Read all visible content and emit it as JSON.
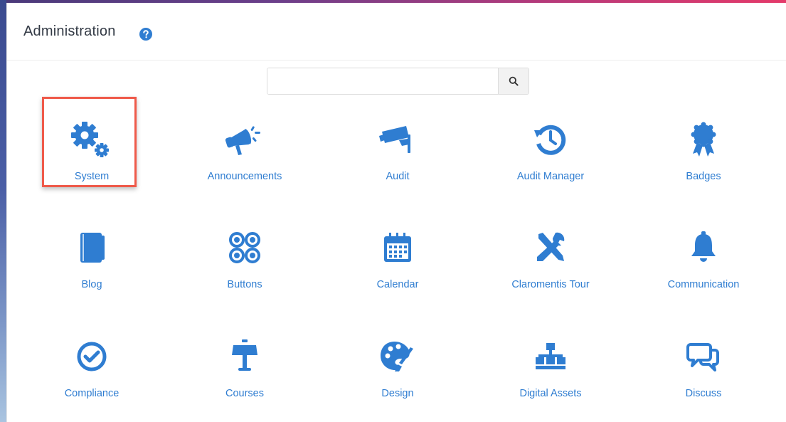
{
  "page": {
    "title": "Administration",
    "search_placeholder": "",
    "search_value": ""
  },
  "colors": {
    "accent": "#2f7dd1",
    "highlight": "#ef5a4a",
    "title_text": "#333a45"
  },
  "items": [
    {
      "label": "System",
      "icon": "gears-icon",
      "highlighted": true
    },
    {
      "label": "Announcements",
      "icon": "megaphone-icon"
    },
    {
      "label": "Audit",
      "icon": "security-camera-icon"
    },
    {
      "label": "Audit Manager",
      "icon": "history-icon"
    },
    {
      "label": "Badges",
      "icon": "award-ribbon-icon"
    },
    {
      "label": "Blog",
      "icon": "notebook-icon"
    },
    {
      "label": "Buttons",
      "icon": "four-circles-icon"
    },
    {
      "label": "Calendar",
      "icon": "calendar-icon"
    },
    {
      "label": "Claromentis Tour",
      "icon": "tools-icon"
    },
    {
      "label": "Communication",
      "icon": "bell-icon"
    },
    {
      "label": "Compliance",
      "icon": "check-circle-icon"
    },
    {
      "label": "Courses",
      "icon": "lectern-icon"
    },
    {
      "label": "Design",
      "icon": "palette-icon"
    },
    {
      "label": "Digital Assets",
      "icon": "sitemap-icon"
    },
    {
      "label": "Discuss",
      "icon": "chat-bubbles-icon"
    }
  ]
}
